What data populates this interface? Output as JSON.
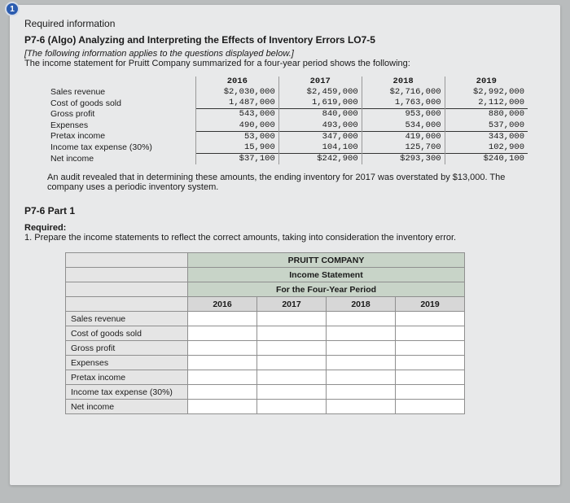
{
  "badge": "1",
  "req_label": "Required information",
  "title": "P7-6 (Algo) Analyzing and Interpreting the Effects of Inventory Errors LO7-5",
  "intro_italic": "[The following information applies to the questions displayed below.]",
  "intro_plain": "The income statement for Pruitt Company summarized for a four-year period shows the following:",
  "row_labels": {
    "sales": "Sales revenue",
    "cogs": "Cost of goods sold",
    "gp": "Gross profit",
    "exp": "Expenses",
    "pretax": "Pretax income",
    "tax": "Income tax expense (30%)",
    "net": "Net income"
  },
  "years": [
    "2016",
    "2017",
    "2018",
    "2019"
  ],
  "data_rows": {
    "sales": [
      "$2,030,000",
      "$2,459,000",
      "$2,716,000",
      "$2,992,000"
    ],
    "cogs": [
      "1,487,000",
      "1,619,000",
      "1,763,000",
      "2,112,000"
    ],
    "gp": [
      "543,000",
      "840,000",
      "953,000",
      "880,000"
    ],
    "exp": [
      "490,000",
      "493,000",
      "534,000",
      "537,000"
    ],
    "pretax": [
      "53,000",
      "347,000",
      "419,000",
      "343,000"
    ],
    "tax": [
      "15,900",
      "104,100",
      "125,700",
      "102,900"
    ],
    "net": [
      "$37,100",
      "$242,900",
      "$293,300",
      "$240,100"
    ]
  },
  "audit_text": "An audit revealed that in determining these amounts, the ending inventory for 2017 was overstated by $13,000. The company uses a periodic inventory system.",
  "part_label": "P7-6 Part 1",
  "required_label": "Required:",
  "required_task": "1. Prepare the income statements to reflect the correct amounts, taking into consideration the inventory error.",
  "answer_headers": {
    "company": "PRUITT COMPANY",
    "stmt": "Income Statement",
    "period": "For the Four-Year Period"
  },
  "answer_years": [
    "2016",
    "2017",
    "2018",
    "2019"
  ],
  "answer_rows": [
    "Sales revenue",
    "Cost of goods sold",
    "Gross profit",
    "Expenses",
    "Pretax income",
    "Income tax expense (30%)",
    "Net income"
  ],
  "chart_data": {
    "type": "table",
    "title": "Pruitt Company Income Statement (four-year period)",
    "categories": [
      "2016",
      "2017",
      "2018",
      "2019"
    ],
    "series": [
      {
        "name": "Sales revenue",
        "values": [
          2030000,
          2459000,
          2716000,
          2992000
        ]
      },
      {
        "name": "Cost of goods sold",
        "values": [
          1487000,
          1619000,
          1763000,
          2112000
        ]
      },
      {
        "name": "Gross profit",
        "values": [
          543000,
          840000,
          953000,
          880000
        ]
      },
      {
        "name": "Expenses",
        "values": [
          490000,
          493000,
          534000,
          537000
        ]
      },
      {
        "name": "Pretax income",
        "values": [
          53000,
          347000,
          419000,
          343000
        ]
      },
      {
        "name": "Income tax expense (30%)",
        "values": [
          15900,
          104100,
          125700,
          102900
        ]
      },
      {
        "name": "Net income",
        "values": [
          37100,
          242900,
          293300,
          240100
        ]
      }
    ]
  }
}
